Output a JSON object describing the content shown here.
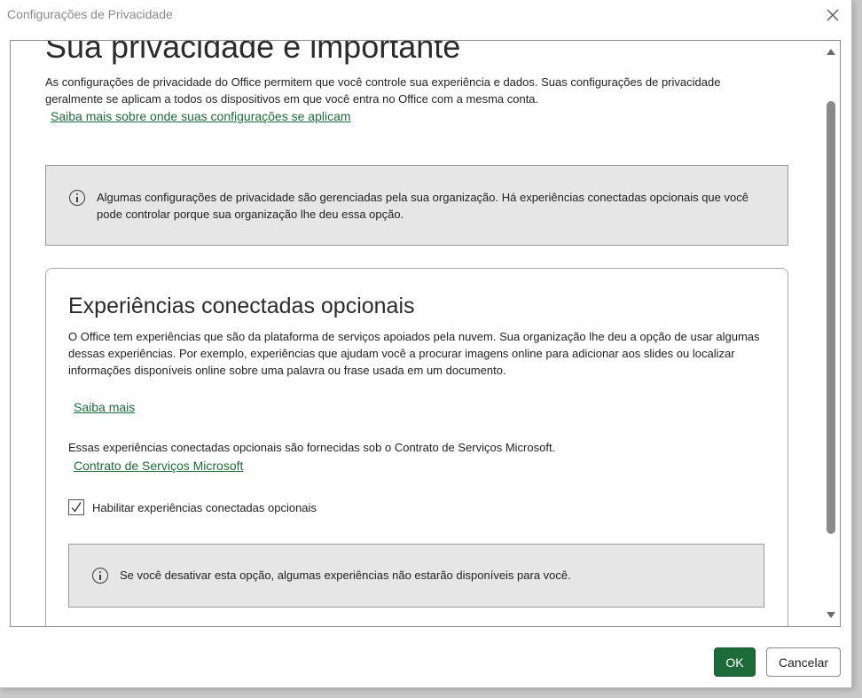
{
  "window": {
    "title": "Configurações de Privacidade"
  },
  "header": {
    "heading": "Sua privacidade é importante",
    "intro": "As configurações de privacidade do Office permitem que você controle sua experiência e dados. Suas configurações de privacidade geralmente se aplicam a todos os dispositivos em que você entra no Office com a mesma conta.",
    "where_link": "Saiba mais sobre onde suas configurações se aplicam"
  },
  "org_notice": {
    "icon": "info-icon",
    "text": "Algumas configurações de privacidade são gerenciadas pela sua organização. Há experiências conectadas opcionais que você pode controlar porque sua organização lhe deu essa opção."
  },
  "optional_experiences": {
    "title": "Experiências conectadas opcionais",
    "description": "O Office tem experiências que são da plataforma de serviços apoiados pela nuvem. Sua organização lhe deu a opção de usar algumas dessas experiências. Por exemplo, experiências que ajudam você a procurar imagens online para adicionar aos slides ou localizar informações disponíveis online sobre uma palavra ou frase usada em um documento.",
    "learn_more_link": "Saiba mais",
    "msa_text": "Essas experiências conectadas opcionais são fornecidas sob o Contrato de Serviços Microsoft.",
    "msa_link": "Contrato de Serviços Microsoft",
    "checkbox_label": "Habilitar experiências conectadas opcionais",
    "checkbox_checked": true,
    "off_notice": "Se você desativar esta opção, algumas experiências não estarão disponíveis para você."
  },
  "footer": {
    "ok_label": "OK",
    "cancel_label": "Cancelar"
  },
  "colors": {
    "accent": "#1e6b3a",
    "info_bg": "#e6e6e6"
  }
}
